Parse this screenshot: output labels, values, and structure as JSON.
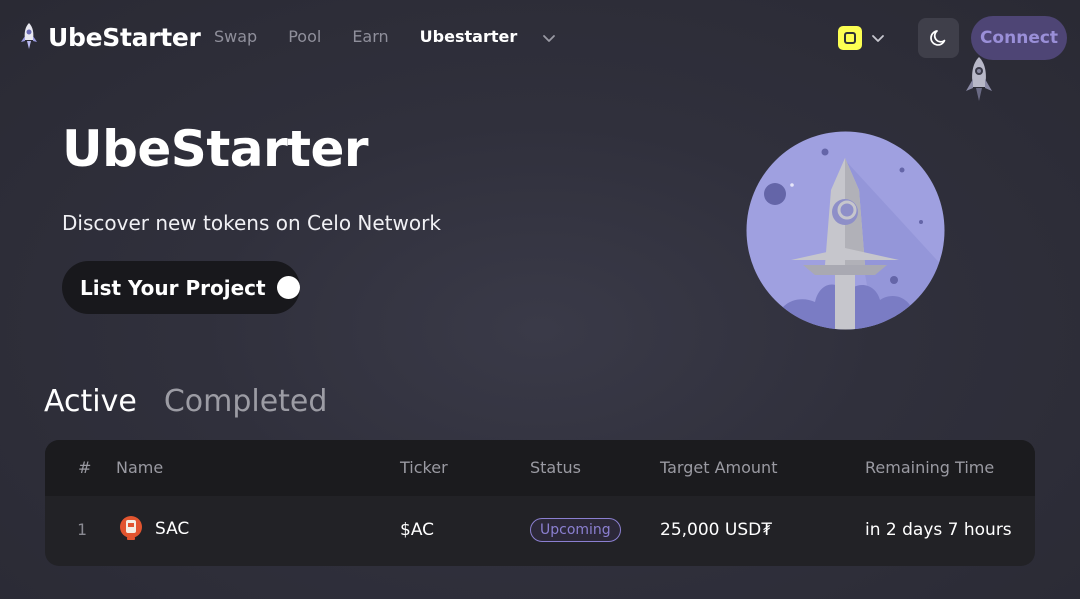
{
  "header": {
    "logo_text": "UbeStarter",
    "nav": [
      {
        "label": "Swap"
      },
      {
        "label": "Pool"
      },
      {
        "label": "Earn"
      },
      {
        "label": "Ubestarter"
      }
    ],
    "connect_label": "Connect"
  },
  "hero": {
    "title": "UbeStarter",
    "subtitle": "Discover new tokens on Celo Network",
    "list_button_label": "List Your Project"
  },
  "tabs": [
    {
      "label": "Active",
      "active": true
    },
    {
      "label": "Completed",
      "active": false
    }
  ],
  "table": {
    "columns": [
      "#",
      "Name",
      "Ticker",
      "Status",
      "Target Amount",
      "Remaining Time"
    ],
    "rows": [
      {
        "index": "1",
        "name": "SAC",
        "ticker": "$AC",
        "status": "Upcoming",
        "target_amount": "25,000 USD₮",
        "remaining_time": "in 2 days 7 hours"
      }
    ]
  },
  "colors": {
    "accent": "#8b7fd0",
    "connect_bg": "#4e4575",
    "celo_yellow": "#fcff52"
  },
  "icons": [
    "rocket-logo-icon",
    "chevron-down-icon",
    "celo-network-icon",
    "moon-icon",
    "rocket-illustration",
    "token-icon"
  ]
}
